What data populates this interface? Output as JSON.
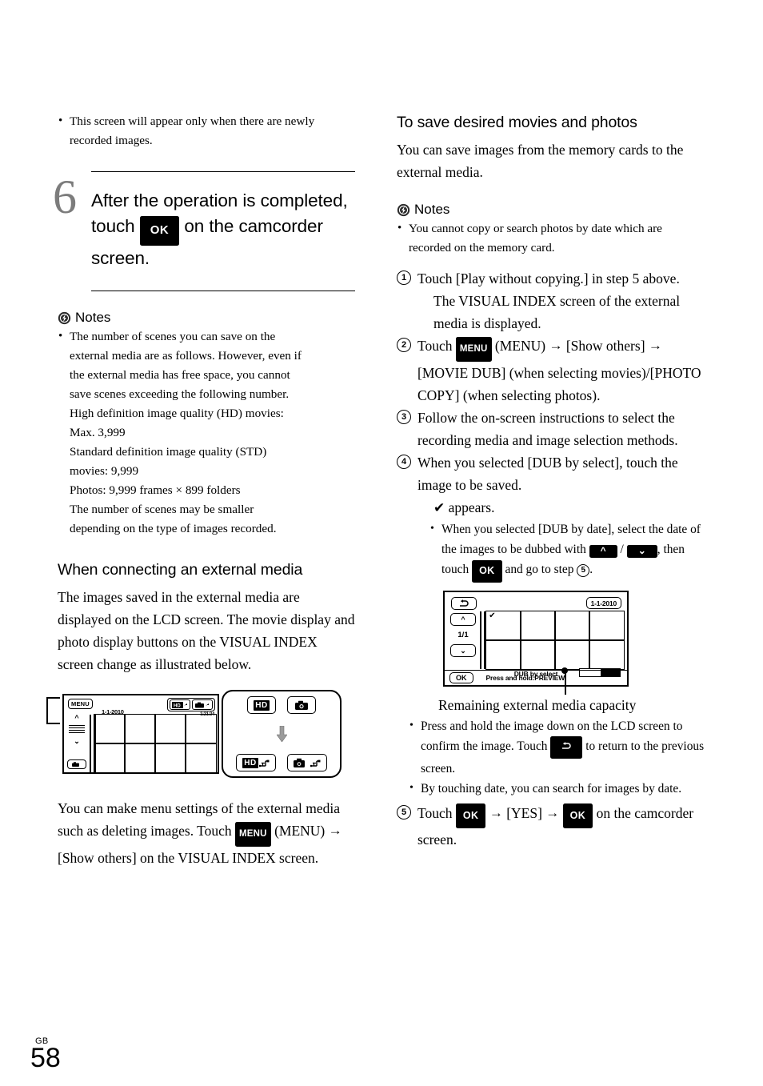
{
  "page": {
    "number": "58",
    "region_code": "GB"
  },
  "icons": {
    "notes": "notes-flash-icon",
    "arrow_right": "→",
    "check": "✔",
    "up_chevron": "︿",
    "down_chevron": "﹀",
    "back": "↰"
  },
  "left_column": {
    "top_bullets": [
      "This screen will appear only when there are newly recorded images."
    ],
    "step": {
      "number": "6",
      "text_part1": "After the operation is completed, touch",
      "ok_chip": "OK",
      "text_part2": "on the camcorder screen."
    },
    "notes_label": "Notes",
    "notes_bullets": [
      "The number of scenes you can save on the external media are as follows. However, even if the external media has free space, you cannot save scenes exceeding the following number. High definition image quality (HD) movies: Max. 3,999 Standard definition image quality (STD) movies: 9,999 Photos: 9,999 frames × 899 folders The number of scenes may be smaller depending on the type of images recorded."
    ],
    "notes_bullet_lines": [
      "The number of scenes you can save on the",
      "external media are as follows. However, even if",
      "the external media has free space, you cannot",
      "save scenes exceeding the following number.",
      "High definition image quality (HD) movies:",
      "Max. 3,999",
      "Standard definition image quality (STD)",
      "movies: 9,999",
      "Photos: 9,999 frames × 899 folders",
      "The number of scenes may be smaller",
      "depending on the type of images recorded."
    ],
    "subhead": "When connecting an external media",
    "paragraph": "The images saved in the external media are displayed on the LCD screen. The movie display and photo display buttons on the VISUAL INDEX screen change as illustrated below.",
    "figure": {
      "menu_button": "MENU",
      "date": "1-1-2010",
      "time": "1:21:34",
      "page_note": "",
      "callout": {
        "hd_label": "HD",
        "hd_usb_label": "HD",
        "photo_label": "",
        "photo_usb_label": ""
      }
    },
    "closing_part1": "You can make menu settings of the external media such as deleting images. Touch",
    "closing_menu_chip": "MENU",
    "closing_part2": "(MENU)",
    "closing_part3": "[Show others] on the VISUAL INDEX screen."
  },
  "right_column": {
    "section_head": "To save desired movies and photos",
    "intro": "You can save images from the memory cards to the external media.",
    "notes_label": "Notes",
    "notes_bullets": [
      "You cannot copy or search photos by date which are recorded on the memory card."
    ],
    "steps": [
      {
        "marker": "1",
        "text": "Touch [Play without copying.] in step 5 above.",
        "sub_text": "The VISUAL INDEX screen of the external media is displayed."
      },
      {
        "marker": "2",
        "text_a": "Touch",
        "menu_chip": "MENU",
        "text_b": "(MENU)",
        "text_c": "[Show others]",
        "text_d": "[MOVIE DUB] (when selecting movies)/[PHOTO COPY] (when selecting photos)."
      },
      {
        "marker": "3",
        "text": "Follow the on-screen instructions to select the recording media and image selection methods."
      },
      {
        "marker": "4",
        "text": "When you selected [DUB by select], touch the image to be saved.",
        "check_line": "appears.",
        "sub_bullet_a": "When you selected [DUB by date], select the date of the images to be dubbed with",
        "sub_bullet_b": ", then touch",
        "sub_bullet_ok": "OK",
        "sub_bullet_c": "and go to step",
        "sub_bullet_step": "5",
        "sub_bullet_end": "."
      },
      {
        "marker": "5",
        "text_a": "Touch",
        "ok_chip_1": "OK",
        "text_b": "[YES]",
        "ok_chip_2": "OK",
        "text_c": "on the camcorder screen."
      }
    ],
    "figure": {
      "date_chip": "1-1-2010",
      "page_indicator": "1/1",
      "dub_label": "DUB by select",
      "ok_button": "OK",
      "press_hold": "Press and hold:PREVIEW"
    },
    "capacity_caption": "Remaining external media capacity",
    "after_figure_bullets": [
      {
        "part_a": "Press and hold the image down on the LCD screen to confirm the image. Touch",
        "part_b": "to return to the previous screen."
      },
      {
        "part_a": "By touching date, you can search for images by date."
      }
    ]
  }
}
